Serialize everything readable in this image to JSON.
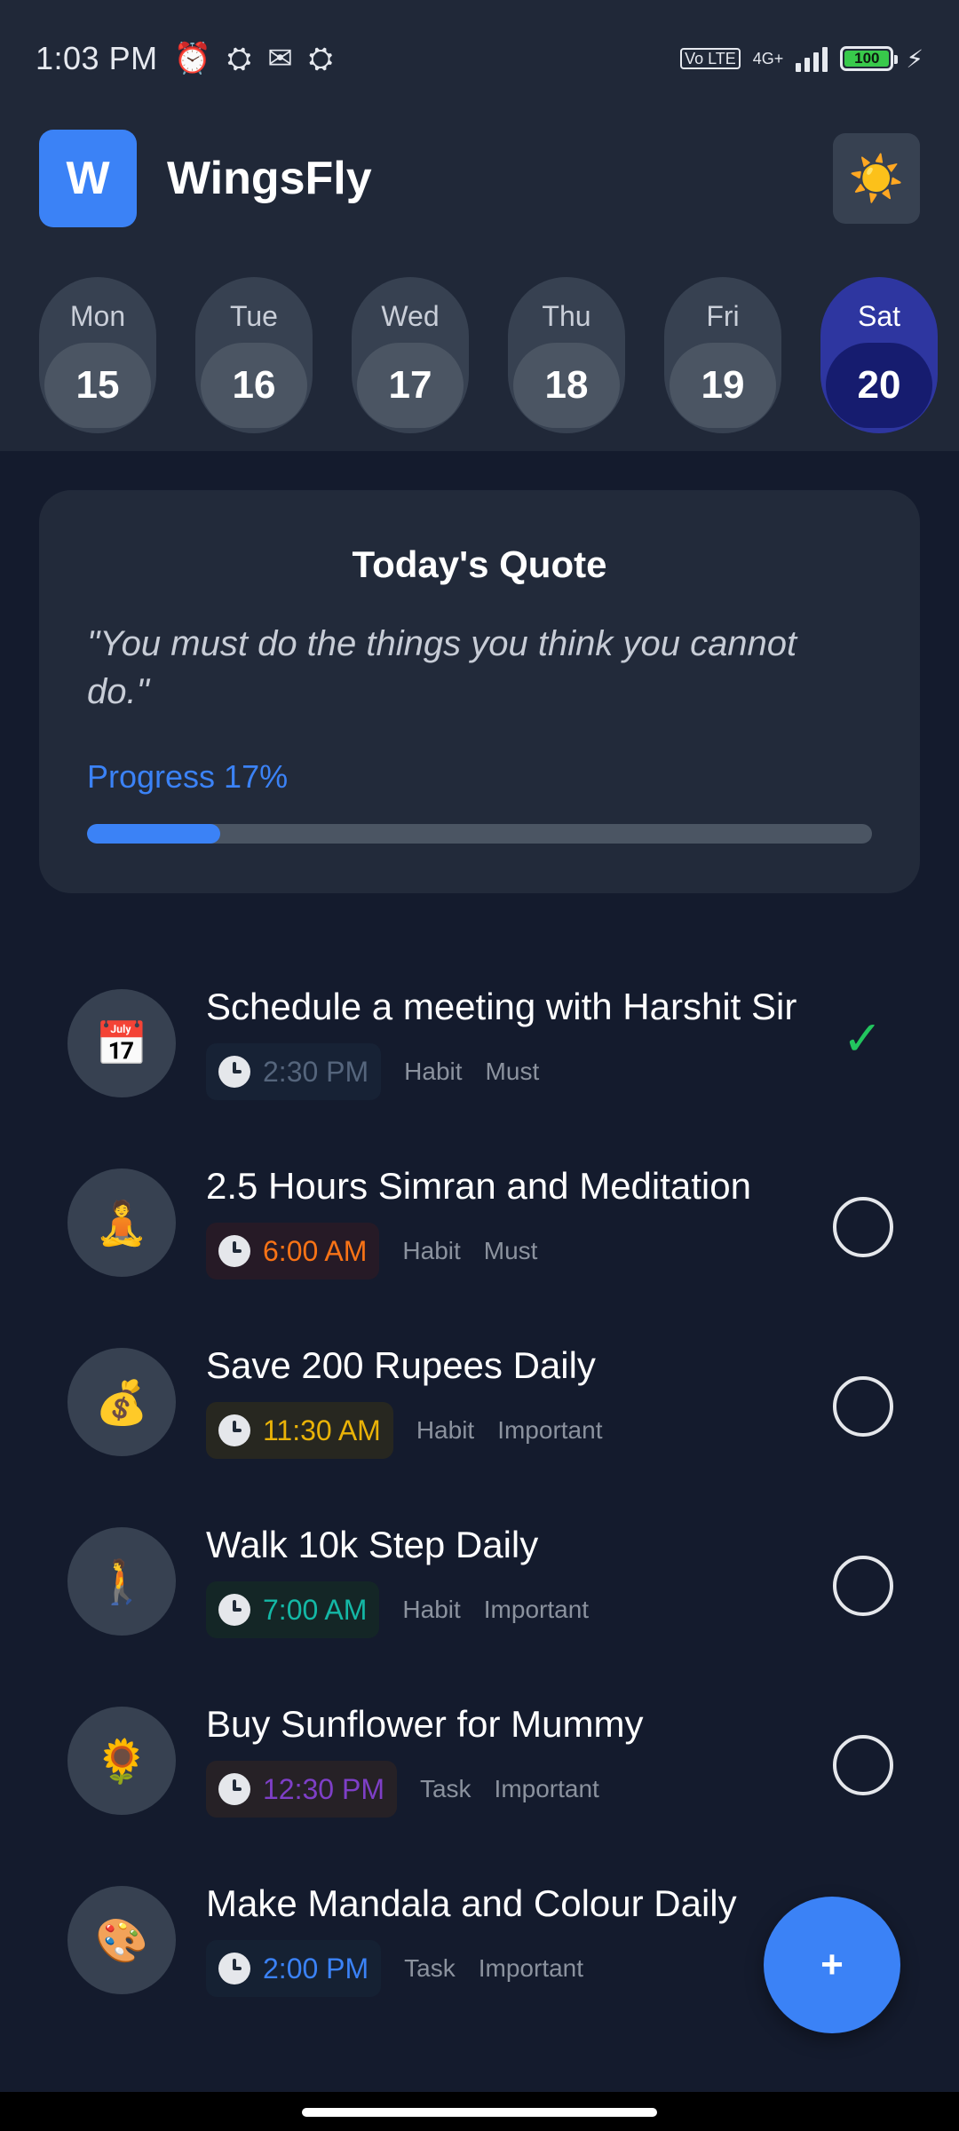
{
  "status_bar": {
    "time": "1:03 PM",
    "icons": [
      "alarm-icon",
      "app-icon",
      "message-icon",
      "app-icon"
    ],
    "volte": "Vo LTE",
    "network": "4G+",
    "battery": "100",
    "charging": true
  },
  "header": {
    "logo_letter": "W",
    "app_name": "WingsFly",
    "theme_icon": "☀️"
  },
  "days": [
    {
      "name": "Mon",
      "num": "15",
      "active": false
    },
    {
      "name": "Tue",
      "num": "16",
      "active": false
    },
    {
      "name": "Wed",
      "num": "17",
      "active": false
    },
    {
      "name": "Thu",
      "num": "18",
      "active": false
    },
    {
      "name": "Fri",
      "num": "19",
      "active": false
    },
    {
      "name": "Sat",
      "num": "20",
      "active": true
    }
  ],
  "quote": {
    "title": "Today's Quote",
    "text": "\"You must do the things you think you cannot do.\"",
    "progress_label": "Progress 17%",
    "progress_fraction": 0.17
  },
  "tasks": [
    {
      "icon": "📅",
      "icon_name": "calendar-icon",
      "title": "Schedule a meeting with Harshit Sir",
      "time": "2:30 PM",
      "time_color": "#55657c",
      "pill_bg": "#172235",
      "tags": [
        "Habit",
        "Must"
      ],
      "done": true
    },
    {
      "icon": "🧘",
      "icon_name": "meditation-icon",
      "title": "2.5 Hours Simran and Meditation",
      "time": "6:00 AM",
      "time_color": "#f97316",
      "pill_bg": "#261a26",
      "tags": [
        "Habit",
        "Must"
      ],
      "done": false
    },
    {
      "icon": "💰",
      "icon_name": "money-bag-icon",
      "title": "Save 200 Rupees Daily",
      "time": "11:30 AM",
      "time_color": "#eab308",
      "pill_bg": "#272720",
      "tags": [
        "Habit",
        "Important"
      ],
      "done": false
    },
    {
      "icon": "🚶",
      "icon_name": "walking-icon",
      "title": "Walk 10k Step Daily",
      "time": "7:00 AM",
      "time_color": "#14b8a6",
      "pill_bg": "#142626",
      "tags": [
        "Habit",
        "Important"
      ],
      "done": false
    },
    {
      "icon": "🌻",
      "icon_name": "sunflower-icon",
      "title": "Buy Sunflower for Mummy",
      "time": "12:30 PM",
      "time_color": "#7e3fc7",
      "pill_bg": "#262126",
      "tags": [
        "Task",
        "Important"
      ],
      "done": false
    },
    {
      "icon": "🎨",
      "icon_name": "palette-icon",
      "title": "Make Mandala and Colour Daily",
      "time": "2:00 PM",
      "time_color": "#3b82f6",
      "pill_bg": "#152133",
      "tags": [
        "Task",
        "Important"
      ],
      "done": false
    }
  ],
  "fab": {
    "label": "+"
  }
}
